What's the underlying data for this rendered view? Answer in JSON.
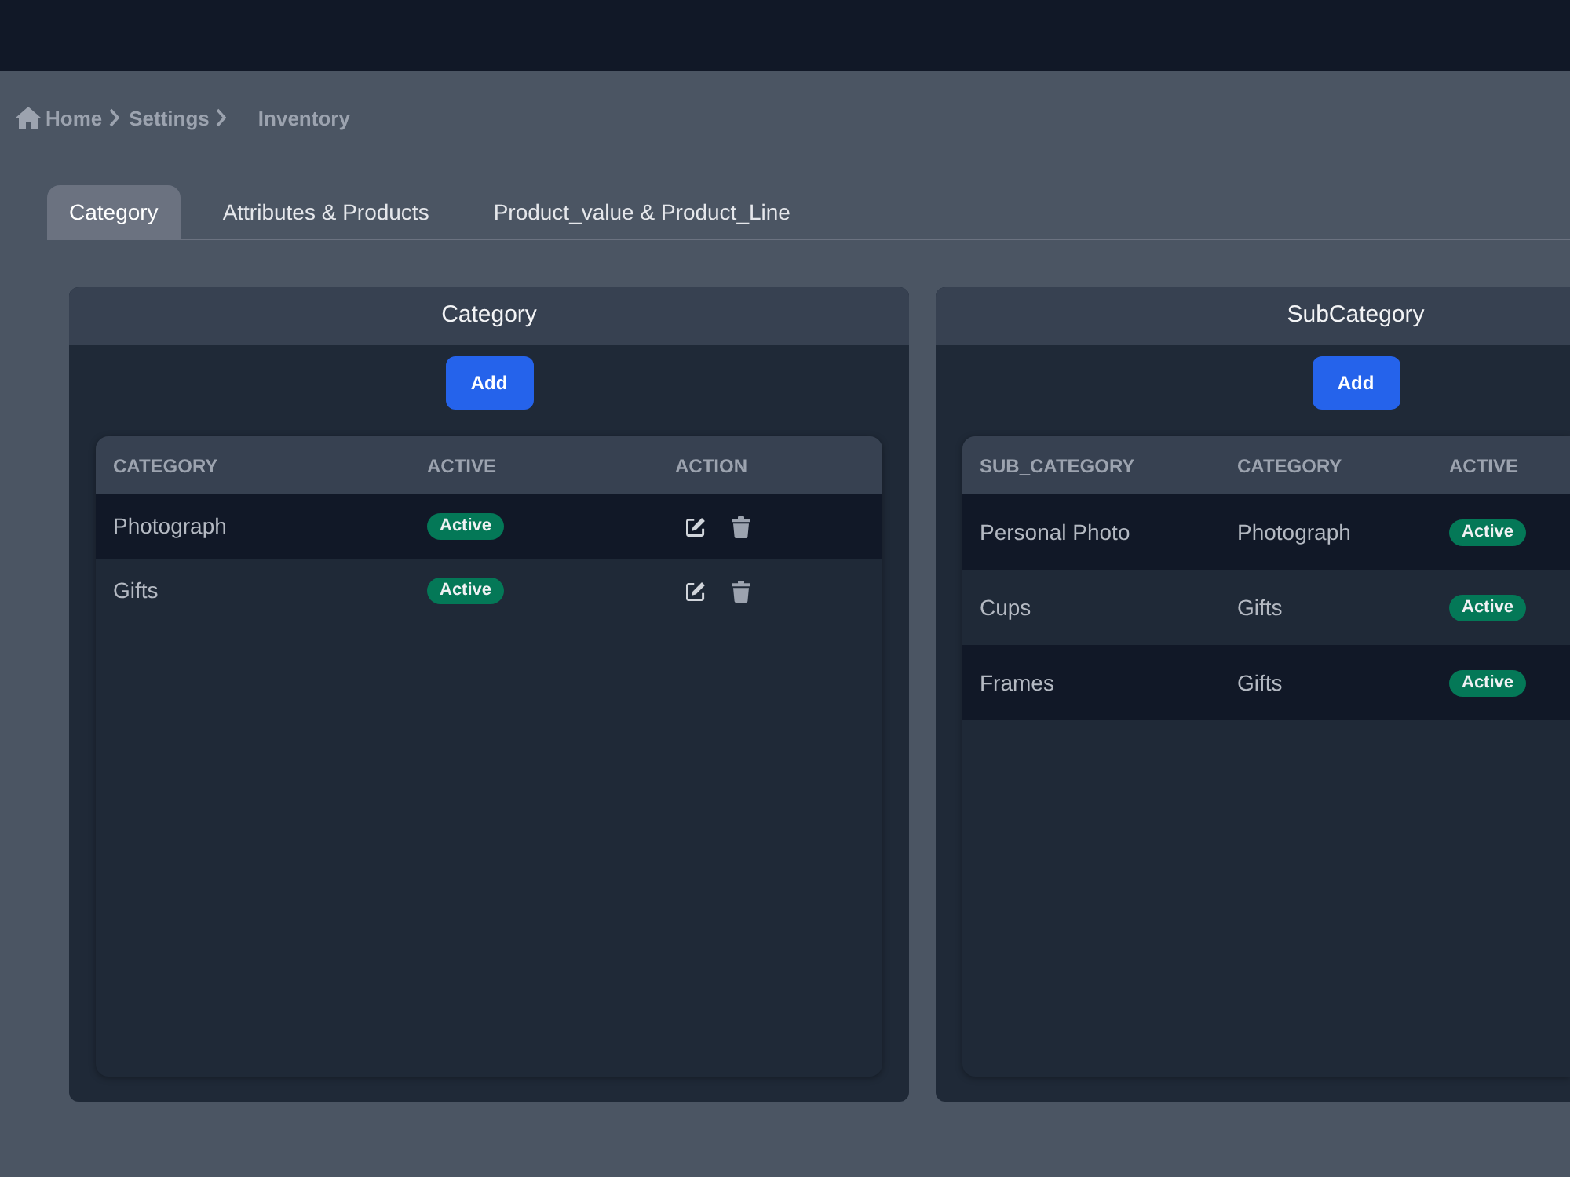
{
  "breadcrumb": [
    {
      "label": "Home"
    },
    {
      "label": "Settings"
    },
    {
      "label": "Inventory"
    }
  ],
  "tabs": [
    {
      "label": "Category",
      "selected": true
    },
    {
      "label": "Attributes & Products",
      "selected": false
    },
    {
      "label": "Product_value & Product_Line",
      "selected": false
    }
  ],
  "panels": [
    {
      "title": "Category",
      "add_button": "Add",
      "table": {
        "columns": [
          "CATEGORY",
          "ACTIVE",
          "ACTION"
        ],
        "rows": [
          [
            {
              "kind": "text",
              "text": "Photograph"
            },
            {
              "kind": "badge",
              "text": "Active"
            },
            {
              "kind": "actions"
            }
          ],
          [
            {
              "kind": "text",
              "text": "Gifts"
            },
            {
              "kind": "badge",
              "text": "Active"
            },
            {
              "kind": "actions"
            }
          ]
        ]
      }
    },
    {
      "title": "SubCategory",
      "add_button": "Add",
      "table": {
        "columns": [
          "SUB_CATEGORY",
          "CATEGORY",
          "ACTIVE"
        ],
        "rows": [
          [
            {
              "kind": "text",
              "text": "Personal Photo"
            },
            {
              "kind": "text",
              "text": "Photograph"
            },
            {
              "kind": "badge",
              "text": "Active"
            }
          ],
          [
            {
              "kind": "text",
              "text": "Cups"
            },
            {
              "kind": "text",
              "text": "Gifts"
            },
            {
              "kind": "badge",
              "text": "Active"
            }
          ],
          [
            {
              "kind": "text",
              "text": "Frames"
            },
            {
              "kind": "text",
              "text": "Gifts"
            },
            {
              "kind": "badge",
              "text": "Active"
            }
          ]
        ]
      }
    }
  ]
}
